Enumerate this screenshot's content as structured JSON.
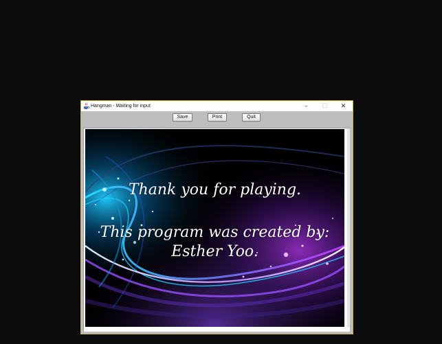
{
  "window": {
    "title": "Hangman - Waiting for input",
    "controls": {
      "minimize": "–",
      "maximize": "☐",
      "close": "✕"
    },
    "frame_color": "#c8b23a"
  },
  "toolbar": {
    "save_label": "Save",
    "print_label": "Print",
    "quit_label": "Quit"
  },
  "canvas": {
    "line1": "Thank you for playing.",
    "line2": "This program was created by:",
    "line3": "Esther Yoo.",
    "background_style": "dark abstract swirl wallpaper",
    "accent_colors": [
      "#19c8ff",
      "#8a3dff",
      "#c23dff",
      "#3a9bff"
    ]
  },
  "icons": {
    "app": "java-coffee-cup-icon"
  }
}
